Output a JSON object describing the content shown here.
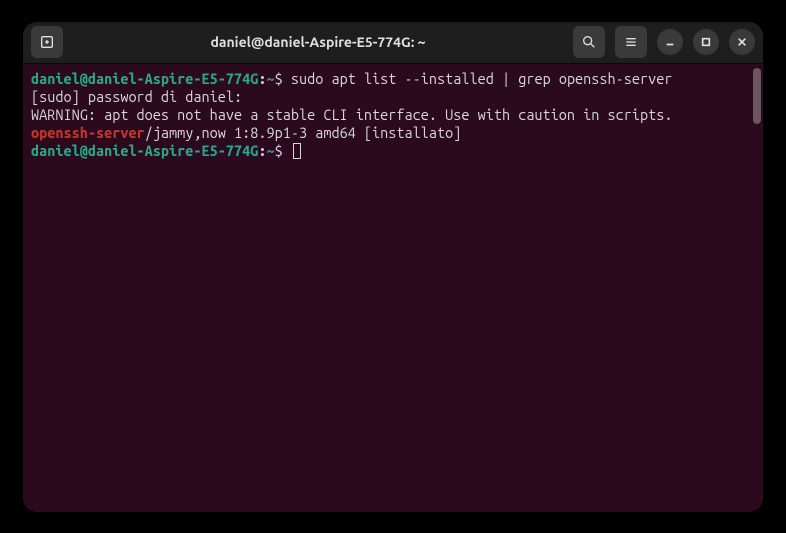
{
  "window": {
    "title": "daniel@daniel-Aspire-E5-774G: ~"
  },
  "terminal": {
    "prompt_user": "daniel@daniel-Aspire-E5-774G",
    "prompt_path": "~",
    "command1": "sudo apt list --installed | grep openssh-server",
    "sudo_prompt": "[sudo] password di daniel: ",
    "blank1": "",
    "warning": "WARNING: apt does not have a stable CLI interface. Use with caution in scripts.",
    "blank2": "",
    "match_pkg": "openssh-server",
    "match_rest": "/jammy,now 1:8.9p1-3 amd64 [installato]"
  }
}
